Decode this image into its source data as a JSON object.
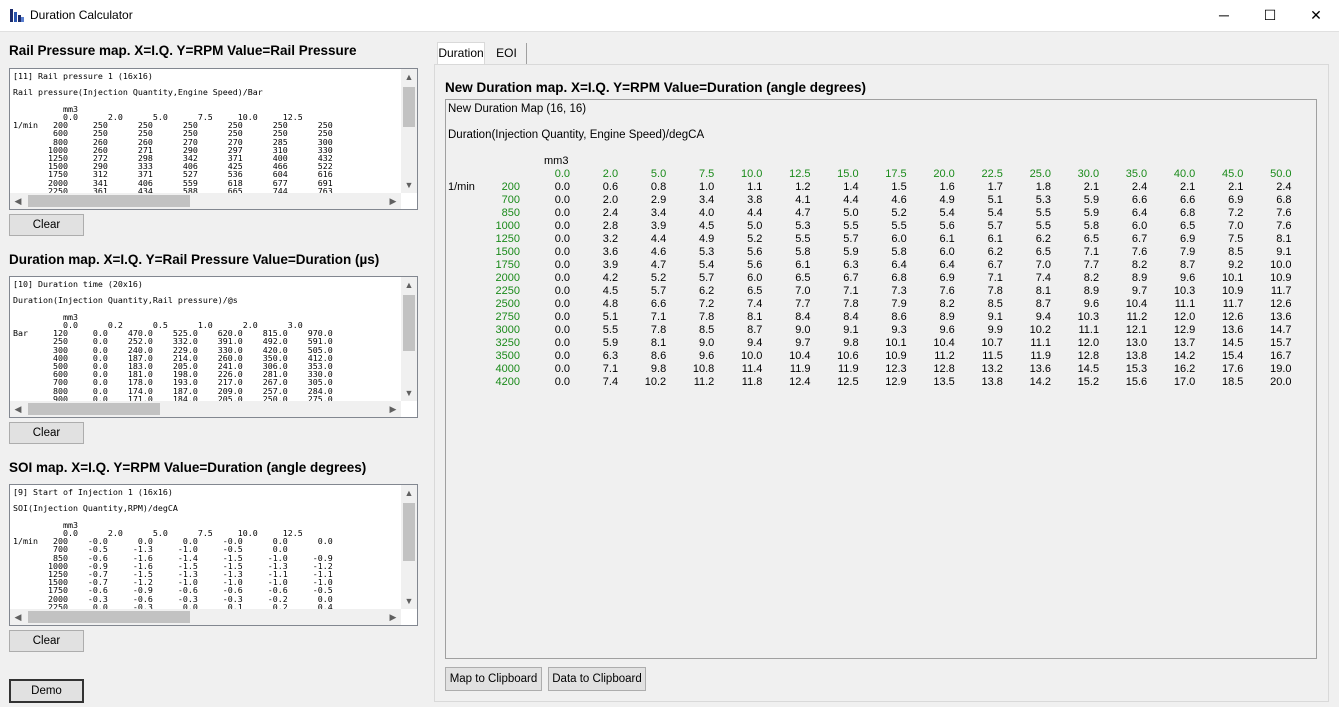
{
  "window": {
    "title": "Duration Calculator",
    "minimize": "─",
    "maximize": "☐",
    "close": "✕"
  },
  "left": {
    "rail": {
      "heading": "Rail Pressure map. X=I.Q. Y=RPM  Value=Rail Pressure",
      "lines": [
        "[11] Rail pressure 1 (16x16)",
        "",
        "Rail pressure(Injection Quantity,Engine Speed)/Bar",
        "",
        "          mm3",
        "          0.0      2.0      5.0      7.5     10.0     12.5",
        "1/min   200     250      250      250      250      250      250",
        "        600     250      250      250      250      250      250",
        "        800     260      260      270      270      285      300",
        "       1000     260      271      290      297      310      330",
        "       1250     272      298      342      371      400      432",
        "       1500     290      333      406      425      466      522",
        "       1750     312      371      527      536      604      616",
        "       2000     341      406      559      618      677      691",
        "       2250     361      434      588      665      744      763"
      ],
      "clear": "Clear"
    },
    "duration": {
      "heading": "Duration map. X=I.Q. Y=Rail Pressure  Value=Duration (µs)",
      "lines": [
        "[10] Duration time (20x16)",
        "",
        "Duration(Injection Quantity,Rail pressure)/@s",
        "",
        "          mm3",
        "          0.0      0.2      0.5      1.0      2.0      3.0",
        "Bar     120     0.0    470.0    525.0    620.0    815.0    970.0",
        "        250     0.0    252.0    332.0    391.0    492.0    591.0",
        "        300     0.0    240.0    229.0    330.0    420.0    505.0",
        "        400     0.0    187.0    214.0    260.0    350.0    412.0",
        "        500     0.0    183.0    205.0    241.0    306.0    353.0",
        "        600     0.0    181.0    198.0    226.0    281.0    330.0",
        "        700     0.0    178.0    193.0    217.0    267.0    305.0",
        "        800     0.0    174.0    187.0    209.0    257.0    284.0",
        "        900     0.0    171.0    184.0    205.0    250.0    275.0"
      ],
      "clear": "Clear"
    },
    "soi": {
      "heading": "SOI map. X=I.Q.  Y=RPM  Value=Duration (angle degrees)",
      "lines": [
        "[9] Start of Injection 1 (16x16)",
        "",
        "SOI(Injection Quantity,RPM)/degCA",
        "",
        "          mm3",
        "          0.0      2.0      5.0      7.5     10.0     12.5",
        "1/min   200    -0.0      0.0      0.0     -0.0      0.0      0.0",
        "        700    -0.5     -1.3     -1.0     -0.5      0.0",
        "        850    -0.6     -1.6     -1.4     -1.5     -1.0     -0.9",
        "       1000    -0.9     -1.6     -1.5     -1.5     -1.3     -1.2",
        "       1250    -0.7     -1.5     -1.3     -1.3     -1.1     -1.1",
        "       1500    -0.7     -1.2     -1.0     -1.0     -1.0     -1.0",
        "       1750    -0.6     -0.9     -0.6     -0.6     -0.6     -0.5",
        "       2000    -0.3     -0.6     -0.3     -0.3     -0.2      0.0",
        "       2250     0.0     -0.3      0.0      0.1      0.2      0.4"
      ],
      "clear": "Clear"
    },
    "demo": "Demo"
  },
  "tabs": [
    "Duration",
    "EOI"
  ],
  "right": {
    "heading": "New Duration map. X=I.Q.  Y=RPM  Value=Duration (angle degrees)",
    "map_title": "New Duration Map (16, 16)",
    "map_subtitle": "Duration(Injection Quantity, Engine Speed)/degCA",
    "x_unit": "mm3",
    "y_unit": "1/min",
    "columns": [
      "0.0",
      "2.0",
      "5.0",
      "7.5",
      "10.0",
      "12.5",
      "15.0",
      "17.5",
      "20.0",
      "22.5",
      "25.0",
      "30.0",
      "35.0",
      "40.0",
      "45.0",
      "50.0"
    ],
    "rows": [
      {
        "rpm": "200",
        "values": [
          "0.0",
          "0.6",
          "0.8",
          "1.0",
          "1.1",
          "1.2",
          "1.4",
          "1.5",
          "1.6",
          "1.7",
          "1.8",
          "2.1",
          "2.4",
          "2.1",
          "2.1",
          "2.4"
        ]
      },
      {
        "rpm": "700",
        "values": [
          "0.0",
          "2.0",
          "2.9",
          "3.4",
          "3.8",
          "4.1",
          "4.4",
          "4.6",
          "4.9",
          "5.1",
          "5.3",
          "5.9",
          "6.6",
          "6.6",
          "6.9",
          "6.8"
        ]
      },
      {
        "rpm": "850",
        "values": [
          "0.0",
          "2.4",
          "3.4",
          "4.0",
          "4.4",
          "4.7",
          "5.0",
          "5.2",
          "5.4",
          "5.4",
          "5.5",
          "5.9",
          "6.4",
          "6.8",
          "7.2",
          "7.6"
        ]
      },
      {
        "rpm": "1000",
        "values": [
          "0.0",
          "2.8",
          "3.9",
          "4.5",
          "5.0",
          "5.3",
          "5.5",
          "5.5",
          "5.6",
          "5.7",
          "5.5",
          "5.8",
          "6.0",
          "6.5",
          "7.0",
          "7.6"
        ]
      },
      {
        "rpm": "1250",
        "values": [
          "0.0",
          "3.2",
          "4.4",
          "4.9",
          "5.2",
          "5.5",
          "5.7",
          "6.0",
          "6.1",
          "6.1",
          "6.2",
          "6.5",
          "6.7",
          "6.9",
          "7.5",
          "8.1"
        ]
      },
      {
        "rpm": "1500",
        "values": [
          "0.0",
          "3.6",
          "4.6",
          "5.3",
          "5.6",
          "5.8",
          "5.9",
          "5.8",
          "6.0",
          "6.2",
          "6.5",
          "7.1",
          "7.6",
          "7.9",
          "8.5",
          "9.1"
        ]
      },
      {
        "rpm": "1750",
        "values": [
          "0.0",
          "3.9",
          "4.7",
          "5.4",
          "5.6",
          "6.1",
          "6.3",
          "6.4",
          "6.4",
          "6.7",
          "7.0",
          "7.7",
          "8.2",
          "8.7",
          "9.2",
          "10.0"
        ]
      },
      {
        "rpm": "2000",
        "values": [
          "0.0",
          "4.2",
          "5.2",
          "5.7",
          "6.0",
          "6.5",
          "6.7",
          "6.8",
          "6.9",
          "7.1",
          "7.4",
          "8.2",
          "8.9",
          "9.6",
          "10.1",
          "10.9"
        ]
      },
      {
        "rpm": "2250",
        "values": [
          "0.0",
          "4.5",
          "5.7",
          "6.2",
          "6.5",
          "7.0",
          "7.1",
          "7.3",
          "7.6",
          "7.8",
          "8.1",
          "8.9",
          "9.7",
          "10.3",
          "10.9",
          "11.7"
        ]
      },
      {
        "rpm": "2500",
        "values": [
          "0.0",
          "4.8",
          "6.6",
          "7.2",
          "7.4",
          "7.7",
          "7.8",
          "7.9",
          "8.2",
          "8.5",
          "8.7",
          "9.6",
          "10.4",
          "11.1",
          "11.7",
          "12.6"
        ]
      },
      {
        "rpm": "2750",
        "values": [
          "0.0",
          "5.1",
          "7.1",
          "7.8",
          "8.1",
          "8.4",
          "8.4",
          "8.6",
          "8.9",
          "9.1",
          "9.4",
          "10.3",
          "11.2",
          "12.0",
          "12.6",
          "13.6"
        ]
      },
      {
        "rpm": "3000",
        "values": [
          "0.0",
          "5.5",
          "7.8",
          "8.5",
          "8.7",
          "9.0",
          "9.1",
          "9.3",
          "9.6",
          "9.9",
          "10.2",
          "11.1",
          "12.1",
          "12.9",
          "13.6",
          "14.7"
        ]
      },
      {
        "rpm": "3250",
        "values": [
          "0.0",
          "5.9",
          "8.1",
          "9.0",
          "9.4",
          "9.7",
          "9.8",
          "10.1",
          "10.4",
          "10.7",
          "11.1",
          "12.0",
          "13.0",
          "13.7",
          "14.5",
          "15.7"
        ]
      },
      {
        "rpm": "3500",
        "values": [
          "0.0",
          "6.3",
          "8.6",
          "9.6",
          "10.0",
          "10.4",
          "10.6",
          "10.9",
          "11.2",
          "11.5",
          "11.9",
          "12.8",
          "13.8",
          "14.2",
          "15.4",
          "16.7"
        ]
      },
      {
        "rpm": "4000",
        "values": [
          "0.0",
          "7.1",
          "9.8",
          "10.8",
          "11.4",
          "11.9",
          "11.9",
          "12.3",
          "12.8",
          "13.2",
          "13.6",
          "14.5",
          "15.3",
          "16.2",
          "17.6",
          "19.0"
        ]
      },
      {
        "rpm": "4200",
        "values": [
          "0.0",
          "7.4",
          "10.2",
          "11.2",
          "11.8",
          "12.4",
          "12.5",
          "12.9",
          "13.5",
          "13.8",
          "14.2",
          "15.2",
          "15.6",
          "17.0",
          "18.5",
          "20.0"
        ]
      }
    ],
    "map_to_clipboard": "Map to Clipboard",
    "data_to_clipboard": "Data to Clipboard"
  }
}
